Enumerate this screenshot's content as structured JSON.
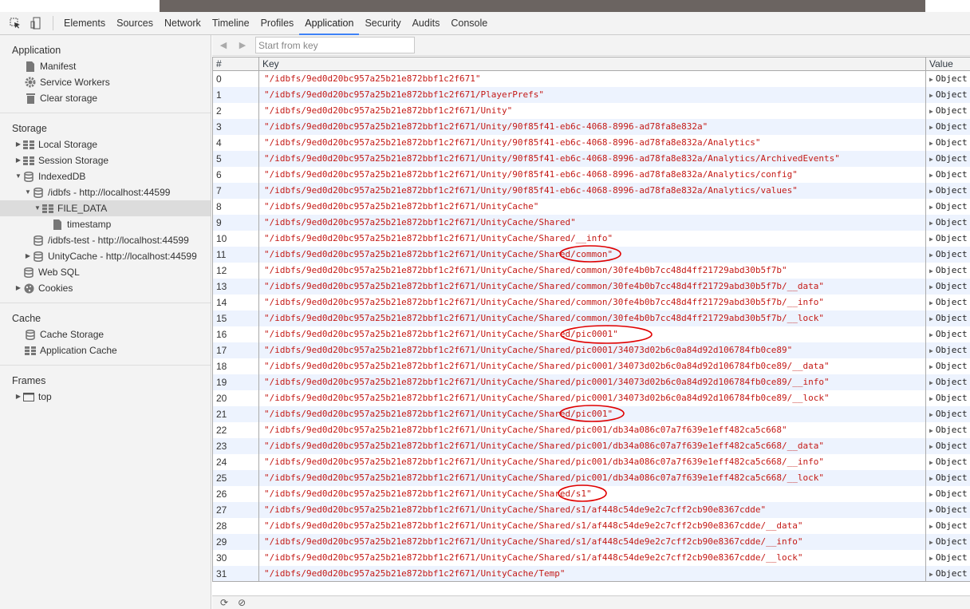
{
  "devtools": {
    "tabs": [
      {
        "label": "Elements"
      },
      {
        "label": "Sources"
      },
      {
        "label": "Network"
      },
      {
        "label": "Timeline"
      },
      {
        "label": "Profiles"
      },
      {
        "label": "Application",
        "active": true
      },
      {
        "label": "Security"
      },
      {
        "label": "Audits"
      },
      {
        "label": "Console"
      }
    ],
    "accent_color": "#3e82f7"
  },
  "sidebar": {
    "application": {
      "title": "Application",
      "items": [
        {
          "label": "Manifest",
          "icon": "file-icon"
        },
        {
          "label": "Service Workers",
          "icon": "gear-icon"
        },
        {
          "label": "Clear storage",
          "icon": "trash-icon"
        }
      ]
    },
    "storage": {
      "title": "Storage",
      "items": [
        {
          "label": "Local Storage",
          "icon": "grid-icon",
          "tri": "▶",
          "indent": 0
        },
        {
          "label": "Session Storage",
          "icon": "grid-icon",
          "tri": "▶",
          "indent": 0
        },
        {
          "label": "IndexedDB",
          "icon": "database-icon",
          "tri": "▼",
          "indent": 0
        },
        {
          "label": "/idbfs - http://localhost:44599",
          "icon": "database-icon",
          "tri": "▼",
          "indent": 1
        },
        {
          "label": "FILE_DATA",
          "icon": "grid-icon",
          "tri": "▼",
          "indent": 2,
          "selected": true
        },
        {
          "label": "timestamp",
          "icon": "file-icon",
          "tri": "",
          "indent": 3
        },
        {
          "label": "/idbfs-test - http://localhost:44599",
          "icon": "database-icon",
          "tri": "",
          "indent": 1
        },
        {
          "label": "UnityCache - http://localhost:44599",
          "icon": "database-icon",
          "tri": "▶",
          "indent": 1
        },
        {
          "label": "Web SQL",
          "icon": "database-icon",
          "tri": "",
          "indent": 0
        },
        {
          "label": "Cookies",
          "icon": "cookie-icon",
          "tri": "▶",
          "indent": 0
        }
      ]
    },
    "cache": {
      "title": "Cache",
      "items": [
        {
          "label": "Cache Storage",
          "icon": "database-icon"
        },
        {
          "label": "Application Cache",
          "icon": "grid-icon"
        }
      ]
    },
    "frames": {
      "title": "Frames",
      "items": [
        {
          "label": "top",
          "icon": "frame-icon",
          "tri": "▶"
        }
      ]
    }
  },
  "main": {
    "key_input_placeholder": "Start from key",
    "columns": {
      "index": "#",
      "key": "Key",
      "value": "Value"
    },
    "value_label": "Object",
    "rows": [
      "\"/idbfs/9ed0d20bc957a25b21e872bbf1c2f671\"",
      "\"/idbfs/9ed0d20bc957a25b21e872bbf1c2f671/PlayerPrefs\"",
      "\"/idbfs/9ed0d20bc957a25b21e872bbf1c2f671/Unity\"",
      "\"/idbfs/9ed0d20bc957a25b21e872bbf1c2f671/Unity/90f85f41-eb6c-4068-8996-ad78fa8e832a\"",
      "\"/idbfs/9ed0d20bc957a25b21e872bbf1c2f671/Unity/90f85f41-eb6c-4068-8996-ad78fa8e832a/Analytics\"",
      "\"/idbfs/9ed0d20bc957a25b21e872bbf1c2f671/Unity/90f85f41-eb6c-4068-8996-ad78fa8e832a/Analytics/ArchivedEvents\"",
      "\"/idbfs/9ed0d20bc957a25b21e872bbf1c2f671/Unity/90f85f41-eb6c-4068-8996-ad78fa8e832a/Analytics/config\"",
      "\"/idbfs/9ed0d20bc957a25b21e872bbf1c2f671/Unity/90f85f41-eb6c-4068-8996-ad78fa8e832a/Analytics/values\"",
      "\"/idbfs/9ed0d20bc957a25b21e872bbf1c2f671/UnityCache\"",
      "\"/idbfs/9ed0d20bc957a25b21e872bbf1c2f671/UnityCache/Shared\"",
      "\"/idbfs/9ed0d20bc957a25b21e872bbf1c2f671/UnityCache/Shared/__info\"",
      "\"/idbfs/9ed0d20bc957a25b21e872bbf1c2f671/UnityCache/Shared/common\"",
      "\"/idbfs/9ed0d20bc957a25b21e872bbf1c2f671/UnityCache/Shared/common/30fe4b0b7cc48d4ff21729abd30b5f7b\"",
      "\"/idbfs/9ed0d20bc957a25b21e872bbf1c2f671/UnityCache/Shared/common/30fe4b0b7cc48d4ff21729abd30b5f7b/__data\"",
      "\"/idbfs/9ed0d20bc957a25b21e872bbf1c2f671/UnityCache/Shared/common/30fe4b0b7cc48d4ff21729abd30b5f7b/__info\"",
      "\"/idbfs/9ed0d20bc957a25b21e872bbf1c2f671/UnityCache/Shared/common/30fe4b0b7cc48d4ff21729abd30b5f7b/__lock\"",
      "\"/idbfs/9ed0d20bc957a25b21e872bbf1c2f671/UnityCache/Shared/pic0001\"",
      "\"/idbfs/9ed0d20bc957a25b21e872bbf1c2f671/UnityCache/Shared/pic0001/34073d02b6c0a84d92d106784fb0ce89\"",
      "\"/idbfs/9ed0d20bc957a25b21e872bbf1c2f671/UnityCache/Shared/pic0001/34073d02b6c0a84d92d106784fb0ce89/__data\"",
      "\"/idbfs/9ed0d20bc957a25b21e872bbf1c2f671/UnityCache/Shared/pic0001/34073d02b6c0a84d92d106784fb0ce89/__info\"",
      "\"/idbfs/9ed0d20bc957a25b21e872bbf1c2f671/UnityCache/Shared/pic0001/34073d02b6c0a84d92d106784fb0ce89/__lock\"",
      "\"/idbfs/9ed0d20bc957a25b21e872bbf1c2f671/UnityCache/Shared/pic001\"",
      "\"/idbfs/9ed0d20bc957a25b21e872bbf1c2f671/UnityCache/Shared/pic001/db34a086c07a7f639e1eff482ca5c668\"",
      "\"/idbfs/9ed0d20bc957a25b21e872bbf1c2f671/UnityCache/Shared/pic001/db34a086c07a7f639e1eff482ca5c668/__data\"",
      "\"/idbfs/9ed0d20bc957a25b21e872bbf1c2f671/UnityCache/Shared/pic001/db34a086c07a7f639e1eff482ca5c668/__info\"",
      "\"/idbfs/9ed0d20bc957a25b21e872bbf1c2f671/UnityCache/Shared/pic001/db34a086c07a7f639e1eff482ca5c668/__lock\"",
      "\"/idbfs/9ed0d20bc957a25b21e872bbf1c2f671/UnityCache/Shared/s1\"",
      "\"/idbfs/9ed0d20bc957a25b21e872bbf1c2f671/UnityCache/Shared/s1/af448c54de9e2c7cff2cb90e8367cdde\"",
      "\"/idbfs/9ed0d20bc957a25b21e872bbf1c2f671/UnityCache/Shared/s1/af448c54de9e2c7cff2cb90e8367cdde/__data\"",
      "\"/idbfs/9ed0d20bc957a25b21e872bbf1c2f671/UnityCache/Shared/s1/af448c54de9e2c7cff2cb90e8367cdde/__info\"",
      "\"/idbfs/9ed0d20bc957a25b21e872bbf1c2f671/UnityCache/Shared/s1/af448c54de9e2c7cff2cb90e8367cdde/__lock\"",
      "\"/idbfs/9ed0d20bc957a25b21e872bbf1c2f671/UnityCache/Temp\""
    ],
    "annotation_color": "#e00000"
  }
}
